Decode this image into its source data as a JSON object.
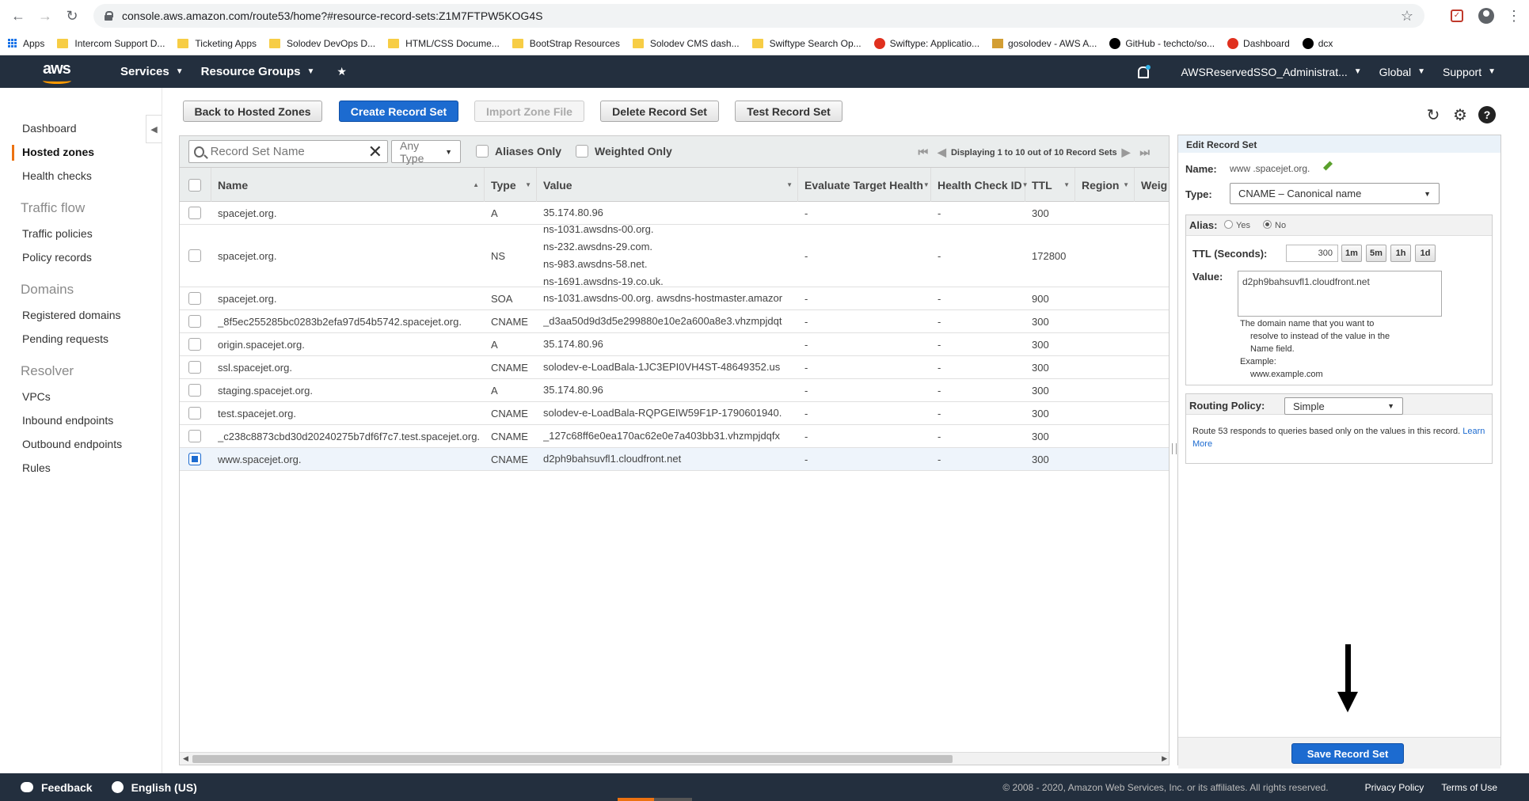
{
  "browser": {
    "url": "console.aws.amazon.com/route53/home?#resource-record-sets:Z1M7FTPW5KOG4S",
    "bookmarks": [
      "Apps",
      "Intercom Support D...",
      "Ticketing Apps",
      "Solodev DevOps D...",
      "HTML/CSS Docume...",
      "BootStrap Resources",
      "Solodev CMS dash...",
      "Swiftype Search Op...",
      "Swiftype: Applicatio...",
      "gosolodev - AWS A...",
      "GitHub - techcto/so...",
      "Dashboard",
      "dcx"
    ]
  },
  "aws_nav": {
    "logo": "aws",
    "services": "Services",
    "resource_groups": "Resource Groups",
    "account": "AWSReservedSSO_Administrat...",
    "region": "Global",
    "support": "Support"
  },
  "sidebar": {
    "items": [
      "Dashboard",
      "Hosted zones",
      "Health checks"
    ],
    "traffic_flow": {
      "heading": "Traffic flow",
      "items": [
        "Traffic policies",
        "Policy records"
      ]
    },
    "domains": {
      "heading": "Domains",
      "items": [
        "Registered domains",
        "Pending requests"
      ]
    },
    "resolver": {
      "heading": "Resolver",
      "items": [
        "VPCs",
        "Inbound endpoints",
        "Outbound endpoints",
        "Rules"
      ]
    }
  },
  "toolbar": {
    "back": "Back to Hosted Zones",
    "create": "Create Record Set",
    "import": "Import Zone File",
    "delete": "Delete Record Set",
    "test": "Test Record Set"
  },
  "filters": {
    "search_placeholder": "Record Set Name",
    "type": "Any Type",
    "aliases_only": "Aliases Only",
    "weighted_only": "Weighted Only",
    "pager_text": "Displaying 1 to 10 out of 10 Record Sets"
  },
  "columns": [
    "Name",
    "Type",
    "Value",
    "Evaluate Target Health",
    "Health Check ID",
    "TTL",
    "Region",
    "Weig"
  ],
  "records": [
    {
      "name": "spacejet.org.",
      "type": "A",
      "value": [
        "35.174.80.96"
      ],
      "eth": "-",
      "hc": "-",
      "ttl": "300"
    },
    {
      "name": "spacejet.org.",
      "type": "NS",
      "value": [
        "ns-1031.awsdns-00.org.",
        "ns-232.awsdns-29.com.",
        "ns-983.awsdns-58.net.",
        "ns-1691.awsdns-19.co.uk."
      ],
      "eth": "-",
      "hc": "-",
      "ttl": "172800"
    },
    {
      "name": "spacejet.org.",
      "type": "SOA",
      "value": [
        "ns-1031.awsdns-00.org. awsdns-hostmaster.amazor"
      ],
      "eth": "-",
      "hc": "-",
      "ttl": "900"
    },
    {
      "name": "_8f5ec255285bc0283b2efa97d54b5742.spacejet.org.",
      "type": "CNAME",
      "value": [
        "_d3aa50d9d3d5e299880e10e2a600a8e3.vhzmpjdqt"
      ],
      "eth": "-",
      "hc": "-",
      "ttl": "300"
    },
    {
      "name": "origin.spacejet.org.",
      "type": "A",
      "value": [
        "35.174.80.96"
      ],
      "eth": "-",
      "hc": "-",
      "ttl": "300"
    },
    {
      "name": "ssl.spacejet.org.",
      "type": "CNAME",
      "value": [
        "solodev-e-LoadBala-1JC3EPI0VH4ST-48649352.us"
      ],
      "eth": "-",
      "hc": "-",
      "ttl": "300"
    },
    {
      "name": "staging.spacejet.org.",
      "type": "A",
      "value": [
        "35.174.80.96"
      ],
      "eth": "-",
      "hc": "-",
      "ttl": "300"
    },
    {
      "name": "test.spacejet.org.",
      "type": "CNAME",
      "value": [
        "solodev-e-LoadBala-RQPGEIW59F1P-1790601940."
      ],
      "eth": "-",
      "hc": "-",
      "ttl": "300"
    },
    {
      "name": "_c238c8873cbd30d20240275b7df6f7c7.test.spacejet.org.",
      "type": "CNAME",
      "value": [
        "_127c68ff6e0ea170ac62e0e7a403bb31.vhzmpjdqfx"
      ],
      "eth": "-",
      "hc": "-",
      "ttl": "300"
    },
    {
      "name": "www.spacejet.org.",
      "type": "CNAME",
      "value": [
        "d2ph9bahsuvfl1.cloudfront.net"
      ],
      "eth": "-",
      "hc": "-",
      "ttl": "300",
      "selected": true
    }
  ],
  "edit_panel": {
    "title": "Edit Record Set",
    "name_label": "Name:",
    "name_value": "www .spacejet.org.",
    "type_label": "Type:",
    "type_value": "CNAME – Canonical name",
    "alias_label": "Alias:",
    "alias_yes": "Yes",
    "alias_no": "No",
    "ttl_label": "TTL (Seconds):",
    "ttl_value": "300",
    "ttl_buttons": [
      "1m",
      "5m",
      "1h",
      "1d"
    ],
    "value_label": "Value:",
    "value": "d2ph9bahsuvfl1.cloudfront.net",
    "hint_lines": [
      "The domain name that you want to",
      "resolve to instead of the value in the",
      "Name field."
    ],
    "example_label": "Example:",
    "example_value": "www.example.com",
    "routing_label": "Routing Policy:",
    "routing_value": "Simple",
    "routing_text": "Route 53 responds to queries based only on the values in this record.",
    "learn_more": "Learn More",
    "save": "Save Record Set"
  },
  "footer": {
    "feedback": "Feedback",
    "language": "English (US)",
    "copyright": "© 2008 - 2020, Amazon Web Services, Inc. or its affiliates. All rights reserved.",
    "privacy": "Privacy Policy",
    "terms": "Terms of Use"
  }
}
